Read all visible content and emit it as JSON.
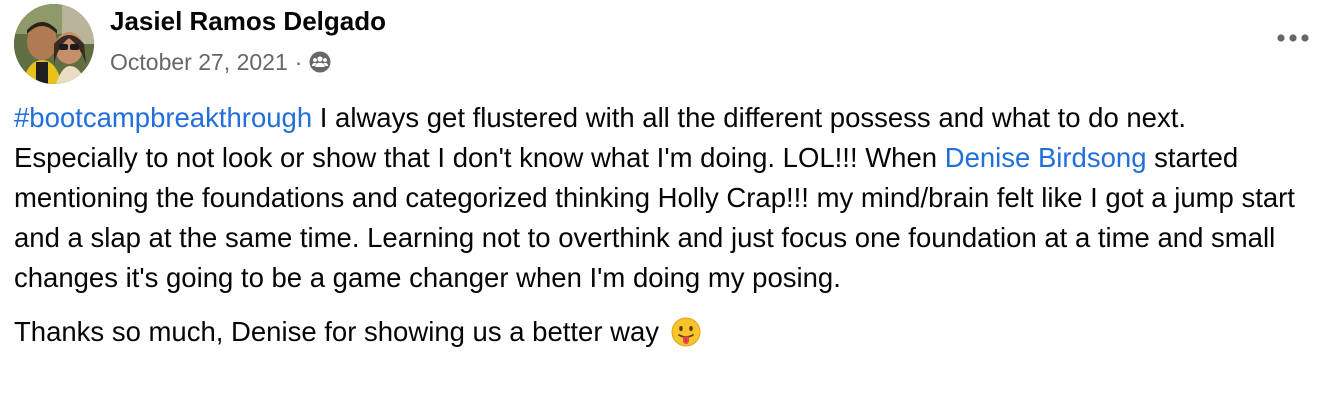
{
  "post": {
    "author": "Jasiel Ramos Delgado",
    "date": "October 27, 2021",
    "separator": "·",
    "audience_icon": "friends-icon",
    "more_icon": "more-options-icon",
    "body": {
      "hashtag": "#bootcampbreakthrough",
      "text_1": " I always get flustered with all the different possess and what to do next. Especially to not look or show that I don't know what I'm doing. LOL!!! When ",
      "mention": "Denise Birdsong",
      "text_2": " started mentioning the foundations and categorized thinking Holly Crap!!! my mind/brain felt like I got a jump start and a slap at the same time. Learning not to overthink and just focus one foundation at a time and small changes it's going to be a game changer when I'm doing my posing.",
      "paragraph_2": "Thanks so much, Denise for showing us a better way ",
      "emoji": "tongue-out-face-icon"
    }
  },
  "colors": {
    "text": "#050505",
    "secondary_text": "#65676b",
    "link": "#216fdb",
    "emoji_face": "#f7c42b"
  }
}
